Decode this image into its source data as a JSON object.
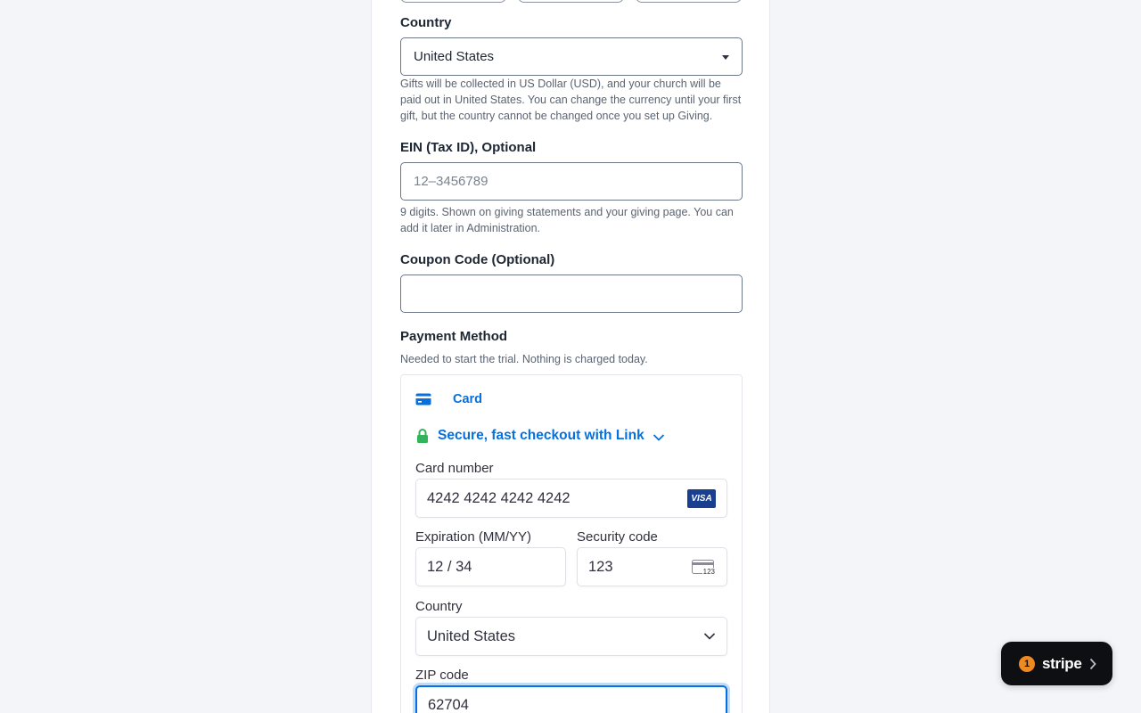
{
  "form": {
    "country_label": "Country",
    "country_value": "United States",
    "country_help": "Gifts will be collected in US Dollar (USD), and your church will be paid out in United States. You can change the currency until your first gift, but the country cannot be changed once you set up Giving.",
    "ein_label": "EIN (Tax ID), Optional",
    "ein_placeholder": "12–3456789",
    "ein_help": "9 digits. Shown on giving statements and your giving page. You can add it later in Administration.",
    "coupon_label": "Coupon Code (Optional)",
    "coupon_value": "",
    "payment_label": "Payment Method",
    "payment_help": "Needed to start the trial. Nothing is charged today."
  },
  "stripe_element": {
    "tab_card_label": "Card",
    "link_label": "Secure, fast checkout with Link",
    "card_number_label": "Card number",
    "card_number_value": "4242 4242 4242 4242",
    "card_brand": "VISA",
    "expiration_label": "Expiration (MM/YY)",
    "expiration_value": "12 / 34",
    "security_label": "Security code",
    "security_value": "123",
    "cvc_icon_text": "123",
    "country_label": "Country",
    "country_value": "United States",
    "zip_label": "ZIP code",
    "zip_value": "62704"
  },
  "stripe_badge": {
    "count": "1",
    "brand": "stripe"
  },
  "colors": {
    "accent_blue": "#0570de",
    "link_green": "#33b35a",
    "badge_bg": "#0d0f12",
    "badge_count": "#ee8a1f",
    "visa_blue": "#1a3f8f"
  }
}
